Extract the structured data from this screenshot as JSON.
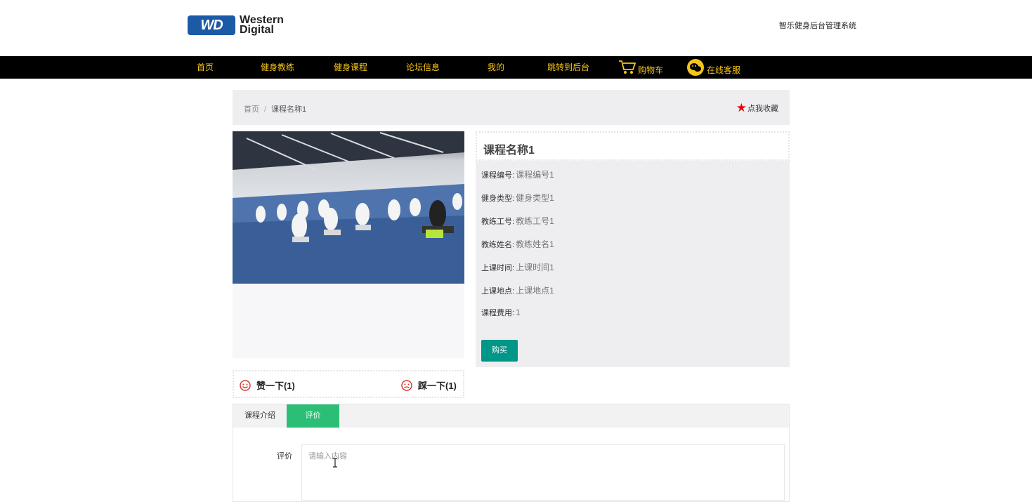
{
  "header": {
    "logo_mark": "WD",
    "logo_line1": "Western",
    "logo_line2": "Digital",
    "system_title": "智乐健身后台管理系统"
  },
  "nav": {
    "items": [
      {
        "label": "首页"
      },
      {
        "label": "健身教练"
      },
      {
        "label": "健身课程"
      },
      {
        "label": "论坛信息"
      },
      {
        "label": "我的"
      },
      {
        "label": "跳转到后台"
      },
      {
        "label": "购物车",
        "icon": "cart-icon"
      },
      {
        "label": "在线客服",
        "icon": "chat-icon"
      }
    ],
    "color": "#f5c518"
  },
  "breadcrumb": {
    "home": "首页",
    "separator": "/",
    "current": "课程名称1",
    "favorite_label": "点我收藏"
  },
  "course": {
    "title": "课程名称1",
    "fields": [
      {
        "label": "课程编号:",
        "value": "课程编号1"
      },
      {
        "label": "健身类型:",
        "value": "健身类型1"
      },
      {
        "label": "教练工号:",
        "value": "教练工号1"
      },
      {
        "label": "教练姓名:",
        "value": "教练姓名1"
      },
      {
        "label": "上课时间:",
        "value": "上课时间1"
      },
      {
        "label": "上课地点:",
        "value": "上课地点1"
      },
      {
        "label": "课程费用:",
        "value": "1"
      }
    ],
    "buy_label": "购买",
    "buy_color": "#009688"
  },
  "votes": {
    "like_label": "赞一下(1)",
    "dislike_label": "踩一下(1)"
  },
  "tabs": {
    "items": [
      {
        "label": "课程介绍"
      },
      {
        "label": "评价"
      }
    ],
    "active_color": "#2dbe76"
  },
  "review": {
    "label": "评价",
    "placeholder": "请输入内容"
  }
}
